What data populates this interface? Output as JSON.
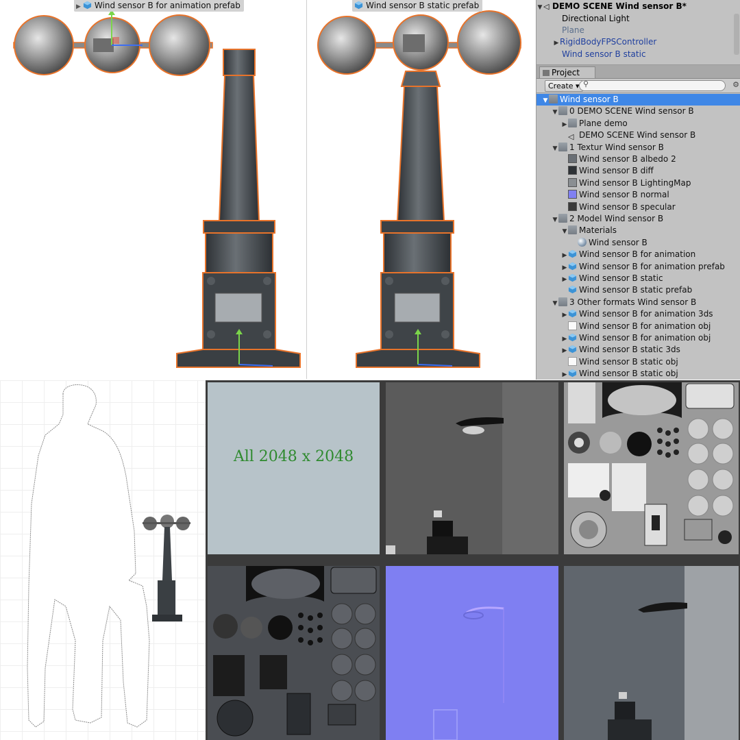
{
  "viewports": [
    {
      "label": "Wind sensor B for animation prefab"
    },
    {
      "label": "Wind sensor B static prefab"
    }
  ],
  "hierarchy": {
    "scene_title": "DEMO SCENE Wind sensor B*",
    "items": [
      "Directional Light",
      "Plane",
      "RigidBodyFPSController",
      "Wind sensor B static"
    ]
  },
  "project": {
    "tab_label": "Project",
    "create_label": "Create",
    "tree": [
      {
        "label": "Wind sensor B",
        "depth": 0,
        "icon": "folder",
        "arrow": "down",
        "selected": true
      },
      {
        "label": "0 DEMO SCENE Wind sensor B",
        "depth": 1,
        "icon": "folder",
        "arrow": "down"
      },
      {
        "label": "Plane demo",
        "depth": 2,
        "icon": "folder",
        "arrow": "right"
      },
      {
        "label": "DEMO SCENE Wind sensor B",
        "depth": 2,
        "icon": "unity",
        "arrow": ""
      },
      {
        "label": "1 Textur Wind sensor B",
        "depth": 1,
        "icon": "folder",
        "arrow": "down"
      },
      {
        "label": "Wind sensor B albedo 2",
        "depth": 2,
        "icon": "tex-albedo",
        "arrow": ""
      },
      {
        "label": "Wind sensor B diff",
        "depth": 2,
        "icon": "tex-diff",
        "arrow": ""
      },
      {
        "label": "Wind sensor B LightingMap",
        "depth": 2,
        "icon": "tex-light",
        "arrow": ""
      },
      {
        "label": "Wind sensor B normal",
        "depth": 2,
        "icon": "tex-normal",
        "arrow": ""
      },
      {
        "label": "Wind sensor B specular",
        "depth": 2,
        "icon": "tex-spec",
        "arrow": ""
      },
      {
        "label": "2 Model Wind sensor B",
        "depth": 1,
        "icon": "folder",
        "arrow": "down"
      },
      {
        "label": "Materials",
        "depth": 2,
        "icon": "folder",
        "arrow": "down"
      },
      {
        "label": "Wind sensor B",
        "depth": 3,
        "icon": "material",
        "arrow": ""
      },
      {
        "label": "Wind sensor B for animation",
        "depth": 2,
        "icon": "prefab",
        "arrow": "right"
      },
      {
        "label": "Wind sensor B for animation prefab",
        "depth": 2,
        "icon": "prefab",
        "arrow": "right"
      },
      {
        "label": "Wind sensor B static",
        "depth": 2,
        "icon": "prefab",
        "arrow": "right"
      },
      {
        "label": "Wind sensor B static prefab",
        "depth": 2,
        "icon": "prefab",
        "arrow": ""
      },
      {
        "label": "3 Other formats Wind sensor B",
        "depth": 1,
        "icon": "folder",
        "arrow": "down"
      },
      {
        "label": "Wind sensor B for animation 3ds",
        "depth": 2,
        "icon": "prefab",
        "arrow": "right"
      },
      {
        "label": "Wind sensor B for animation obj",
        "depth": 2,
        "icon": "doc",
        "arrow": ""
      },
      {
        "label": "Wind sensor B for animation obj",
        "depth": 2,
        "icon": "prefab",
        "arrow": "right"
      },
      {
        "label": "Wind sensor B static 3ds",
        "depth": 2,
        "icon": "prefab",
        "arrow": "right"
      },
      {
        "label": "Wind sensor B static obj",
        "depth": 2,
        "icon": "doc",
        "arrow": ""
      },
      {
        "label": "Wind sensor B static obj",
        "depth": 2,
        "icon": "prefab",
        "arrow": "right"
      }
    ]
  },
  "textures": {
    "note": "All 2048 x 2048"
  },
  "colors": {
    "selection": "#3f87e6",
    "outline": "#e8732a",
    "panel": "#c2c2c2",
    "normal_map": "#7f7ff2",
    "note_text": "#2f8a2f"
  }
}
